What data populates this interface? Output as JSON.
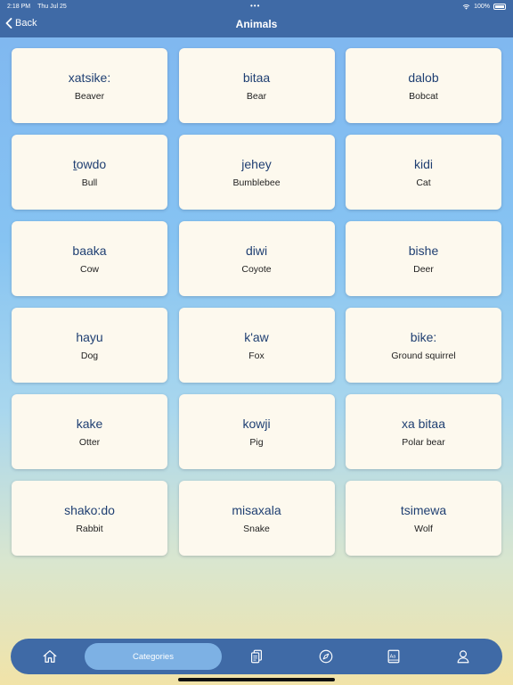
{
  "status": {
    "time": "2:18 PM",
    "date": "Thu Jul 25",
    "battery": "100%"
  },
  "nav": {
    "back_label": "Back",
    "title": "Animals"
  },
  "cards": [
    {
      "native": "xatsike:",
      "english": "Beaver"
    },
    {
      "native": "bitaa",
      "english": "Bear"
    },
    {
      "native": "dalob",
      "english": "Bobcat"
    },
    {
      "native": "t̠owdo",
      "english": "Bull"
    },
    {
      "native": "jehey",
      "english": "Bumblebee"
    },
    {
      "native": "kidi",
      "english": "Cat"
    },
    {
      "native": "baaka",
      "english": "Cow"
    },
    {
      "native": "diwi",
      "english": "Coyote"
    },
    {
      "native": "bishe",
      "english": "Deer"
    },
    {
      "native": "hayu",
      "english": "Dog"
    },
    {
      "native": "k'aw",
      "english": "Fox"
    },
    {
      "native": "bike:",
      "english": "Ground squirrel"
    },
    {
      "native": "kake",
      "english": "Otter"
    },
    {
      "native": "kowji",
      "english": "Pig"
    },
    {
      "native": "xa bitaa",
      "english": "Polar bear"
    },
    {
      "native": "shako:do",
      "english": "Rabbit"
    },
    {
      "native": "misaxala",
      "english": "Snake"
    },
    {
      "native": "tsimewa",
      "english": "Wolf"
    }
  ],
  "tabbar": {
    "active_label": "Categories",
    "icons": [
      "home-icon",
      "categories-tab",
      "cards-icon",
      "compass-icon",
      "dictionary-icon",
      "profile-icon"
    ]
  },
  "colors": {
    "primary": "#3f6aa6",
    "active_tab": "#7db1e4",
    "card": "#fdf9ee",
    "native_text": "#1f3f72"
  }
}
